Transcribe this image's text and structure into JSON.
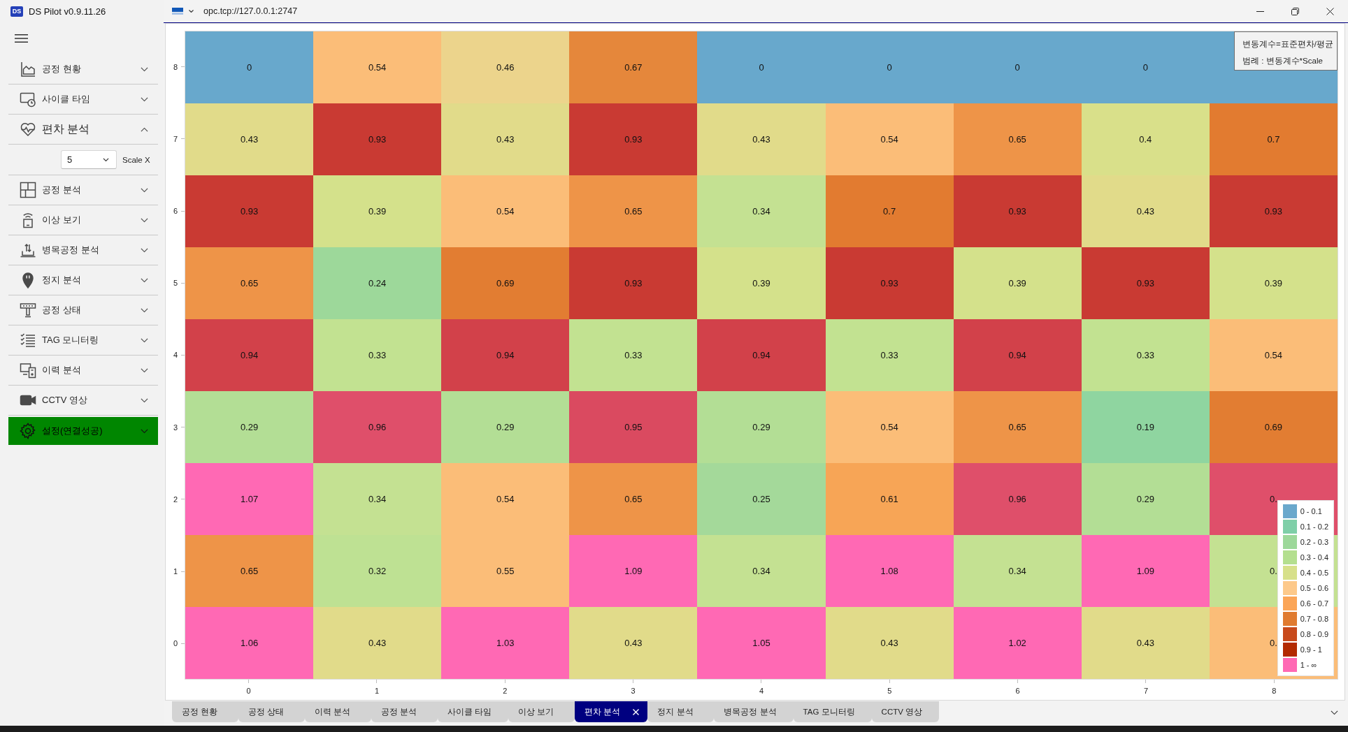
{
  "app": {
    "logo": "DS",
    "title": "DS Pilot v0.9.11.26"
  },
  "sidebar": {
    "items": [
      {
        "label": "공정 현황",
        "kind": "menu",
        "expanded": false
      },
      {
        "label": "사이클 타임",
        "kind": "menu",
        "expanded": false
      },
      {
        "label": "편차 분석",
        "kind": "menu",
        "expanded": true,
        "scale_select": {
          "value": "5"
        },
        "scale_label": "Scale X"
      },
      {
        "label": "공정 분석",
        "kind": "menu",
        "expanded": false
      },
      {
        "label": "이상 보기",
        "kind": "menu",
        "expanded": false
      },
      {
        "label": "병목공정 분석",
        "kind": "menu",
        "expanded": false
      },
      {
        "label": "정지 분석",
        "kind": "menu",
        "expanded": false
      },
      {
        "label": "공정 상태",
        "kind": "menu",
        "expanded": false
      },
      {
        "label": "TAG 모니터링",
        "kind": "menu",
        "expanded": false
      },
      {
        "label": "이력 분석",
        "kind": "menu",
        "expanded": false
      },
      {
        "label": "CCTV 영상",
        "kind": "menu",
        "expanded": false
      },
      {
        "label": "설정(연결성공)",
        "kind": "status",
        "expanded": false
      }
    ]
  },
  "connection": {
    "address": "opc.tcp://127.0.0.1:2747"
  },
  "heatmap": {
    "note": [
      "변동계수=표준편차/평균",
      "범례 : 변동계수*Scale"
    ],
    "rows": [
      {
        "label": "8",
        "cells": [
          {
            "value": "0",
            "color": "#68a8cc"
          },
          {
            "value": "0.54",
            "color": "#fbbd78"
          },
          {
            "value": "0.46",
            "color": "#ecd48c"
          },
          {
            "value": "0.67",
            "color": "#e5873b"
          },
          {
            "value": "0",
            "color": "#68a8cc"
          },
          {
            "value": "0",
            "color": "#68a8cc"
          },
          {
            "value": "0",
            "color": "#68a8cc"
          },
          {
            "value": "0",
            "color": "#68a8cc"
          },
          {
            "color": "#68a8cc"
          }
        ]
      },
      {
        "label": "7",
        "cells": [
          {
            "value": "0.43",
            "color": "#e1db8a"
          },
          {
            "value": "0.93",
            "color": "#c93a33"
          },
          {
            "value": "0.43",
            "color": "#e1db8a"
          },
          {
            "value": "0.93",
            "color": "#c93a33"
          },
          {
            "value": "0.43",
            "color": "#e1db8a"
          },
          {
            "value": "0.54",
            "color": "#fbbd78"
          },
          {
            "value": "0.65",
            "color": "#ee9448"
          },
          {
            "value": "0.4",
            "color": "#d9e08a"
          },
          {
            "value": "0.7",
            "color": "#e27b30"
          }
        ]
      },
      {
        "label": "6",
        "cells": [
          {
            "value": "0.93",
            "color": "#c93a33"
          },
          {
            "value": "0.39",
            "color": "#d4e18b"
          },
          {
            "value": "0.54",
            "color": "#fbbd78"
          },
          {
            "value": "0.65",
            "color": "#ee9448"
          },
          {
            "value": "0.34",
            "color": "#c4e192"
          },
          {
            "value": "0.7",
            "color": "#e27b30"
          },
          {
            "value": "0.93",
            "color": "#c93a33"
          },
          {
            "value": "0.43",
            "color": "#e1db8a"
          },
          {
            "value": "0.93",
            "color": "#c93a33"
          }
        ]
      },
      {
        "label": "5",
        "cells": [
          {
            "value": "0.65",
            "color": "#ee9448"
          },
          {
            "value": "0.24",
            "color": "#9dd89a"
          },
          {
            "value": "0.69",
            "color": "#e27d32"
          },
          {
            "value": "0.93",
            "color": "#c93a33"
          },
          {
            "value": "0.39",
            "color": "#d4e18b"
          },
          {
            "value": "0.93",
            "color": "#c93a33"
          },
          {
            "value": "0.39",
            "color": "#d4e18b"
          },
          {
            "value": "0.93",
            "color": "#c93a33"
          },
          {
            "value": "0.39",
            "color": "#d4e18b"
          }
        ]
      },
      {
        "label": "4",
        "cells": [
          {
            "value": "0.94",
            "color": "#d2414a"
          },
          {
            "value": "0.33",
            "color": "#c2e291"
          },
          {
            "value": "0.94",
            "color": "#d2414a"
          },
          {
            "value": "0.33",
            "color": "#c2e291"
          },
          {
            "value": "0.94",
            "color": "#d2414a"
          },
          {
            "value": "0.33",
            "color": "#c2e291"
          },
          {
            "value": "0.94",
            "color": "#d2414a"
          },
          {
            "value": "0.33",
            "color": "#c2e291"
          },
          {
            "value": "0.54",
            "color": "#fbbd78"
          }
        ]
      },
      {
        "label": "3",
        "cells": [
          {
            "value": "0.29",
            "color": "#b3de95"
          },
          {
            "value": "0.96",
            "color": "#df4f6a"
          },
          {
            "value": "0.29",
            "color": "#b3de95"
          },
          {
            "value": "0.95",
            "color": "#da4a60"
          },
          {
            "value": "0.29",
            "color": "#b3de95"
          },
          {
            "value": "0.54",
            "color": "#fbbd78"
          },
          {
            "value": "0.65",
            "color": "#ee9448"
          },
          {
            "value": "0.19",
            "color": "#8fd5a0"
          },
          {
            "value": "0.69",
            "color": "#e27d32"
          }
        ]
      },
      {
        "label": "2",
        "cells": [
          {
            "value": "1.07",
            "color": "#ff69b4"
          },
          {
            "value": "0.34",
            "color": "#c4e192"
          },
          {
            "value": "0.54",
            "color": "#fbbd78"
          },
          {
            "value": "0.65",
            "color": "#ee9448"
          },
          {
            "value": "0.25",
            "color": "#a4d99a"
          },
          {
            "value": "0.61",
            "color": "#f7a556"
          },
          {
            "value": "0.96",
            "color": "#df4f6a"
          },
          {
            "value": "0.29",
            "color": "#b3de95"
          },
          {
            "value": "0.",
            "color": "#df4f6a"
          }
        ]
      },
      {
        "label": "1",
        "cells": [
          {
            "value": "0.65",
            "color": "#ee9448"
          },
          {
            "value": "0.32",
            "color": "#bee193"
          },
          {
            "value": "0.55",
            "color": "#fbbd78"
          },
          {
            "value": "1.09",
            "color": "#ff69b4"
          },
          {
            "value": "0.34",
            "color": "#c4e192"
          },
          {
            "value": "1.08",
            "color": "#ff69b4"
          },
          {
            "value": "0.34",
            "color": "#c4e192"
          },
          {
            "value": "1.09",
            "color": "#ff69b4"
          },
          {
            "value": "0.",
            "color": "#c4e192"
          }
        ]
      },
      {
        "label": "0",
        "cells": [
          {
            "value": "1.06",
            "color": "#ff69b4"
          },
          {
            "value": "0.43",
            "color": "#e1db8a"
          },
          {
            "value": "1.03",
            "color": "#ff69b4"
          },
          {
            "value": "0.43",
            "color": "#e1db8a"
          },
          {
            "value": "1.05",
            "color": "#ff69b4"
          },
          {
            "value": "0.43",
            "color": "#e1db8a"
          },
          {
            "value": "1.02",
            "color": "#ff69b4"
          },
          {
            "value": "0.43",
            "color": "#e1db8a"
          },
          {
            "value": "0.",
            "color": "#fbbd78"
          }
        ]
      }
    ],
    "x_labels": [
      "0",
      "1",
      "2",
      "3",
      "4",
      "5",
      "6",
      "7",
      "8"
    ],
    "legend": [
      {
        "label": "0 - 0.1",
        "color": "#6aa8cc"
      },
      {
        "label": "0.1 - 0.2",
        "color": "#7fcfa8"
      },
      {
        "label": "0.2 - 0.3",
        "color": "#9dd89a"
      },
      {
        "label": "0.3 - 0.4",
        "color": "#b4df8f"
      },
      {
        "label": "0.4 - 0.5",
        "color": "#d7e08a"
      },
      {
        "label": "0.5 - 0.6",
        "color": "#fdc98a"
      },
      {
        "label": "0.6 - 0.7",
        "color": "#fba557"
      },
      {
        "label": "0.7 - 0.8",
        "color": "#e07b30"
      },
      {
        "label": "0.8 - 0.9",
        "color": "#c84a1c"
      },
      {
        "label": "0.9 - 1",
        "color": "#b32a00"
      },
      {
        "label": "1 - ∞",
        "color": "#ff69b4"
      }
    ]
  },
  "tabs": [
    {
      "label": "공정 현황",
      "selected": false
    },
    {
      "label": "공정 상태",
      "selected": false
    },
    {
      "label": "이력 분석",
      "selected": false
    },
    {
      "label": "공정 분석",
      "selected": false
    },
    {
      "label": "사이클 타임",
      "selected": false
    },
    {
      "label": "이상 보기",
      "selected": false
    },
    {
      "label": "편차 분석",
      "selected": true
    },
    {
      "label": "정지 분석",
      "selected": false
    },
    {
      "label": "병목공정 분석",
      "selected": false
    },
    {
      "label": "TAG 모니터링",
      "selected": false
    },
    {
      "label": "CCTV 영상",
      "selected": false
    }
  ]
}
